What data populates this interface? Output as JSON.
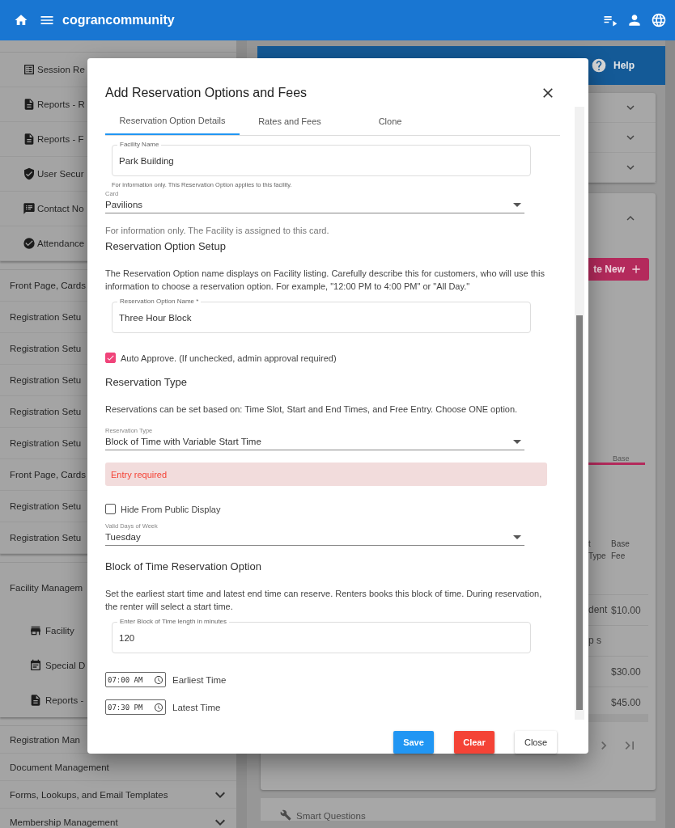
{
  "header": {
    "title": "cograncommunity"
  },
  "sidebar": {
    "groups": [
      {
        "items": [
          {
            "label": "Session Re",
            "kind": "list"
          },
          {
            "label": "Reports - R",
            "kind": "doc"
          },
          {
            "label": "Reports - F",
            "kind": "doc"
          },
          {
            "label": "User Secur",
            "kind": "shield"
          },
          {
            "label": "Contact No",
            "kind": "notes"
          },
          {
            "label": "Attendance",
            "kind": "check"
          }
        ]
      },
      {
        "items": [
          {
            "label": "Front Page, Cards",
            "kind": "text"
          },
          {
            "label": "Registration Setu",
            "kind": "text"
          },
          {
            "label": "Registration Setu",
            "kind": "text"
          },
          {
            "label": "Registration Setu",
            "kind": "text"
          },
          {
            "label": "Registration Setu",
            "kind": "text"
          },
          {
            "label": "Registration Setu",
            "kind": "text"
          },
          {
            "label": "Front Page, Cards",
            "kind": "text"
          },
          {
            "label": "Registration Setu",
            "kind": "text"
          },
          {
            "label": "Registration Setu",
            "kind": "text"
          }
        ]
      },
      {
        "title": "Facility Managem",
        "items": [
          {
            "label": "Facility",
            "kind": "store"
          },
          {
            "label": "Special D",
            "kind": "calendar"
          },
          {
            "label": "Reports -",
            "kind": "doc"
          }
        ]
      },
      {
        "items": [
          {
            "label": "Registration Man",
            "kind": "text"
          },
          {
            "label": "Document Management",
            "kind": "text"
          },
          {
            "label": "Forms, Lookups, and Email Templates",
            "kind": "toggle"
          },
          {
            "label": "Membership Management",
            "kind": "toggle"
          }
        ]
      }
    ]
  },
  "main": {
    "help": "Help",
    "panels": [
      {
        "expanded": false
      },
      {
        "expanded": false
      },
      {
        "expanded": false
      }
    ],
    "detail": {
      "expanded": true,
      "create_button": "te New",
      "tab_label": "Base",
      "columns": [
        "t Type",
        "Base Fee"
      ],
      "rows": [
        {
          "name": "dent",
          "fee": "$10.00"
        },
        {
          "name": "p s"
        },
        {
          "fee": "$30.00"
        },
        {
          "fee": "$45.00"
        }
      ]
    },
    "footer_item": "Smart Questions"
  },
  "modal": {
    "title": "Add Reservation Options and Fees",
    "tabs": [
      {
        "label": "Reservation Option Details",
        "selected": true
      },
      {
        "label": "Rates and Fees",
        "selected": false
      },
      {
        "label": "Clone",
        "selected": false
      }
    ],
    "fields": [
      {
        "kind": "outlined",
        "label": "Facility Name",
        "value": "Park Building",
        "helper": "For information only. This Reservation Option applies to this facility."
      },
      {
        "kind": "select",
        "label": "Card",
        "value": "Pavilions"
      },
      {
        "kind": "hint",
        "text": "For information only. The Facility is assigned to this card."
      },
      {
        "kind": "heading",
        "text": "Reservation Option Setup"
      },
      {
        "kind": "paragraph",
        "text": "The Reservation Option name displays on Facility listing. Carefully describe this for customers, who will use this information to choose a reservation option. For example, \"12:00 PM to 4:00 PM\" or \"All Day.\""
      },
      {
        "kind": "outlined",
        "label": "Reservation Option Name *",
        "value": "Three Hour Block"
      },
      {
        "kind": "checkbox",
        "label": "Auto Approve. (If unchecked, admin approval required)",
        "checked": true
      },
      {
        "kind": "heading",
        "text": "Reservation Type"
      },
      {
        "kind": "paragraph",
        "text": "Reservations can be set based on: Time Slot, Start and End Times, and Free Entry. Choose ONE option."
      },
      {
        "kind": "select",
        "label": "Reservation Type",
        "value": "Block of Time with Variable Start Time"
      },
      {
        "kind": "alert",
        "text": "Entry required"
      },
      {
        "kind": "checkbox",
        "label": "Hide From Public Display",
        "checked": false
      },
      {
        "kind": "select",
        "label": "Valid Days of Week",
        "value": "Tuesday"
      },
      {
        "kind": "heading",
        "text": "Block of Time Reservation Option"
      },
      {
        "kind": "paragraph",
        "text": "Set the earliest start time and latest end time can reserve. Renters books this block of time. During reservation, the renter will select a start time."
      },
      {
        "kind": "outlined",
        "label": "Enter Block of Time length in minutes",
        "value": "120"
      },
      {
        "kind": "time",
        "value": "07:00 AM",
        "label": "Earliest Time"
      },
      {
        "kind": "time",
        "value": "07:30 PM",
        "label": "Latest Time"
      }
    ],
    "buttons": [
      {
        "label": "Save",
        "kind": "primary"
      },
      {
        "label": "Clear",
        "kind": "danger"
      },
      {
        "label": "Close",
        "kind": "plain"
      }
    ]
  }
}
